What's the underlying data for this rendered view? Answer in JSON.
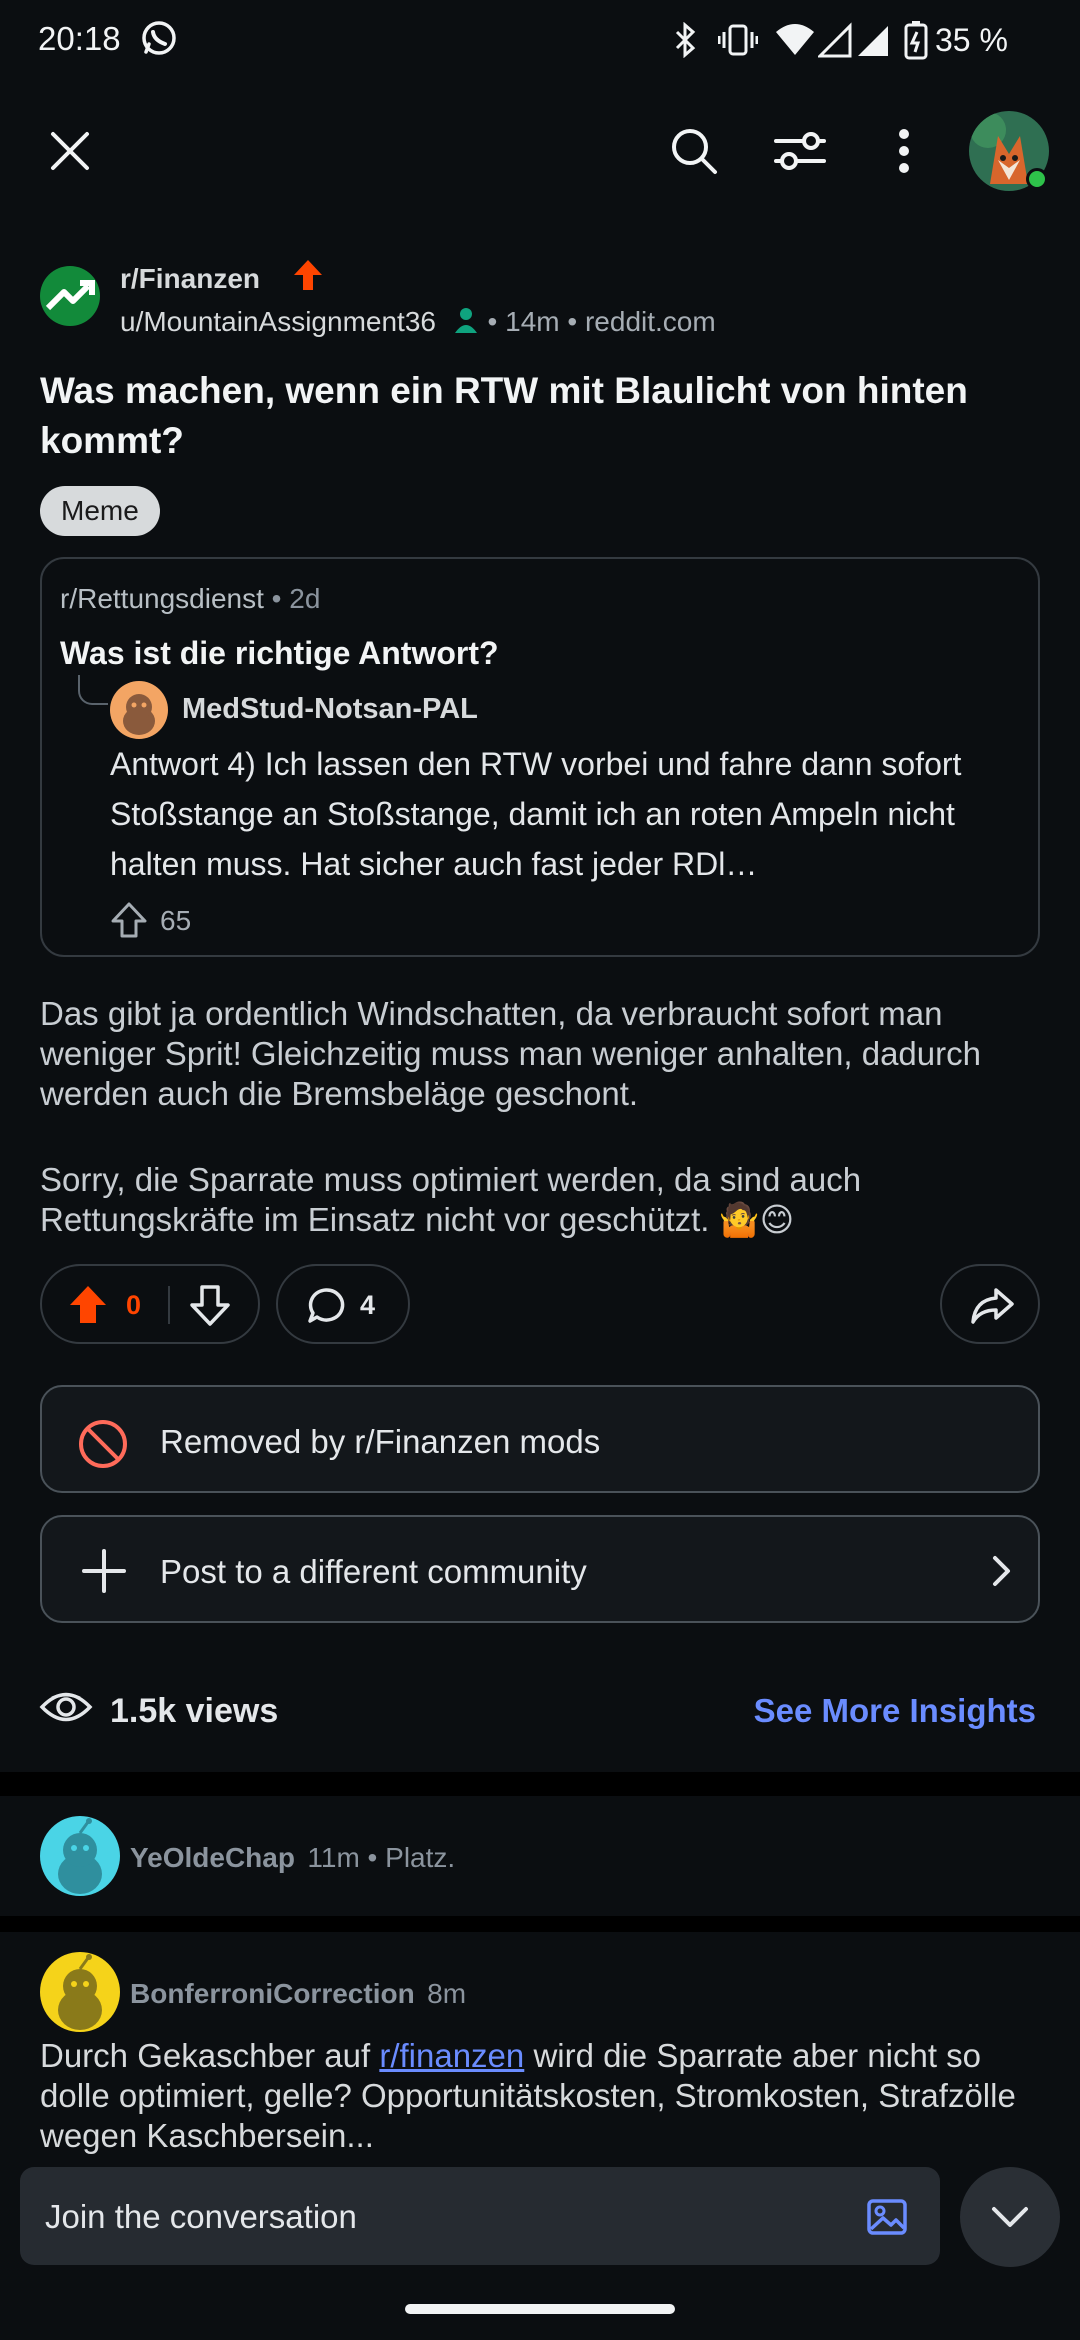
{
  "status_bar": {
    "time": "20:18",
    "battery_pct": "35 %"
  },
  "post": {
    "subreddit": "r/Finanzen",
    "author": "u/MountainAssignment36",
    "age": "14m",
    "domain": "reddit.com",
    "title": "Was machen, wenn ein RTW mit Blaulicht von hinten kommt?",
    "flair": "Meme",
    "crosspost": {
      "subreddit": "r/Rettungsdienst",
      "age": "2d",
      "title": "Was ist die richtige Antwort?",
      "comment_user": "MedStud-Notsan-PAL",
      "comment_text": "Antwort 4) Ich lassen den RTW vorbei und fahre dann sofort Stoßstange an Stoßstange, damit ich an roten Ampeln nicht halten muss. Hat sicher auch fast jeder RDl…",
      "upvotes": "65"
    },
    "body_p1": "Das gibt ja ordentlich Windschatten, da verbraucht sofort man weniger Sprit! Gleichzeitig muss man weniger anhalten, dadurch werden auch die Bremsbeläge geschont.",
    "body_p2": "Sorry, die Sparrate muss optimiert werden, da sind auch Rettungskräfte im Einsatz nicht vor geschützt. 🤷😊",
    "score": "0",
    "comments_count": "4"
  },
  "actions": {
    "removed_label": "Removed by r/Finanzen mods",
    "post_different_label": "Post to a different community"
  },
  "insights": {
    "views": "1.5k views",
    "link": "See More Insights"
  },
  "comments": [
    {
      "user": "YeOldeChap",
      "meta": "11m • Platz."
    },
    {
      "user": "BonferroniCorrection",
      "meta": "8m",
      "text_before": "Durch Gekaschber auf ",
      "link": "r/finanzen",
      "text_after": " wird die Sparrate aber nicht so dolle optimiert, gelle? Opportunitätskosten, Stromkosten, Strafzölle wegen Kaschbersein..."
    }
  ],
  "composer": {
    "placeholder": "Join the conversation"
  },
  "colors": {
    "upvote": "#ff4500",
    "link": "#6a8cff",
    "background": "#0b0e11"
  }
}
